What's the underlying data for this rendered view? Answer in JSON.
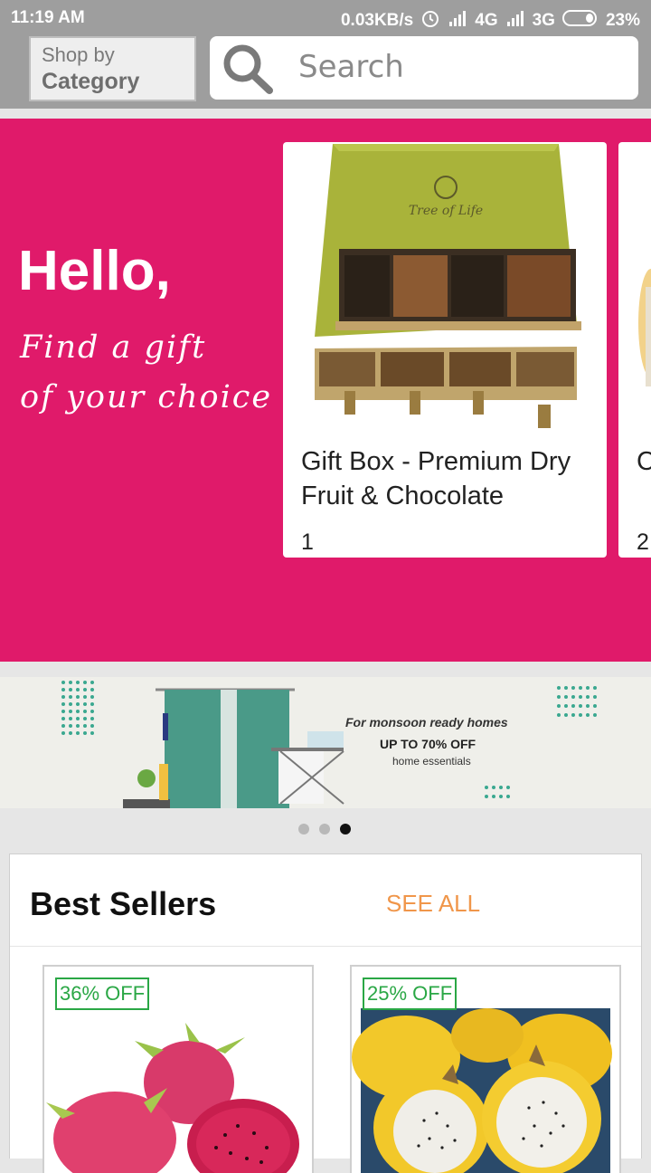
{
  "status_bar": {
    "time": "11:19 AM",
    "speed": "0.03KB/s",
    "network1": "4G",
    "network2": "3G",
    "battery": "23%"
  },
  "toolbar": {
    "shop_line1": "Shop by",
    "shop_line2": "Category",
    "search_placeholder": "Search"
  },
  "hero": {
    "greeting": "Hello,",
    "tagline_line1": "Find a gift",
    "tagline_line2": "of your choice",
    "cards": [
      {
        "name": "Gift Box - Premium Dry Fruit & Chocolate",
        "number": "1",
        "box_label": "Tree of Life"
      },
      {
        "name": "C F",
        "number": "2"
      }
    ]
  },
  "banner": {
    "line1": "For monsoon ready homes",
    "line2": "UP TO 70% OFF",
    "line3": "home essentials"
  },
  "carousel": {
    "page_count": 3,
    "active_index": 2
  },
  "best_sellers": {
    "title": "Best Sellers",
    "see_all": "SEE ALL",
    "products": [
      {
        "discount": "36% OFF",
        "image": "red-dragon-fruit"
      },
      {
        "discount": "25% OFF",
        "image": "yellow-dragon-fruit"
      }
    ]
  },
  "colors": {
    "hero_bg": "#e01a6a",
    "see_all": "#f0964a",
    "discount": "#2aa745",
    "toolbar": "#9e9e9e"
  }
}
